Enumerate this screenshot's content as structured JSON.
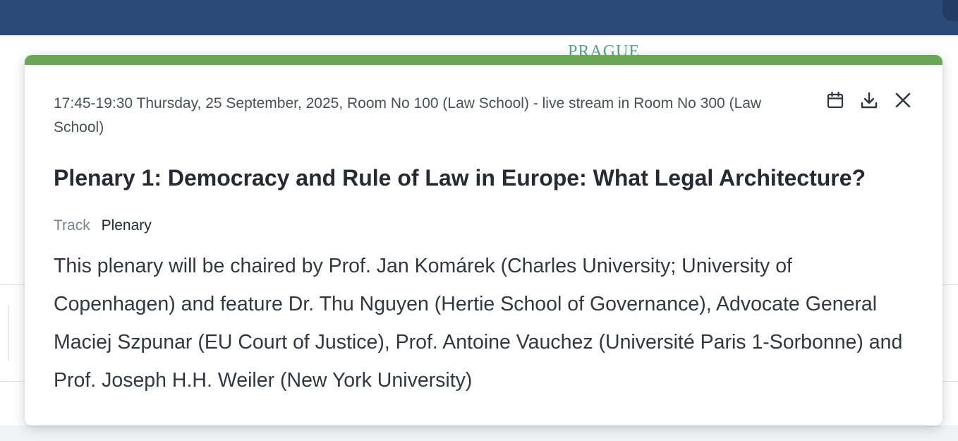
{
  "background": {
    "logo_text": "PRAGUE"
  },
  "session": {
    "meta": "17:45-19:30 Thursday, 25 September, 2025, Room No 100 (Law School) - live stream in Room No 300 (Law School)",
    "title": "Plenary 1: Democracy and Rule of Law in Europe: What Legal Architecture?",
    "track_label": "Track",
    "track_value": "Plenary",
    "description": "This plenary will be chaired by Prof. Jan Komárek (Charles University; University of Copenhagen) and feature Dr. Thu Nguyen (Hertie School of Governance), Advocate General Maciej Szpunar (EU Court of Justice), Prof. Antoine Vauchez (Université Paris 1-Sorbonne) and Prof. Joseph H.H. Weiler (New York University)"
  },
  "actions": [
    {
      "icon": "calendar-icon"
    },
    {
      "icon": "download-icon"
    },
    {
      "icon": "close-icon"
    }
  ],
  "colors": {
    "topbar": "#2c4a78",
    "accent": "#6aa757",
    "logo": "#52a98a"
  }
}
